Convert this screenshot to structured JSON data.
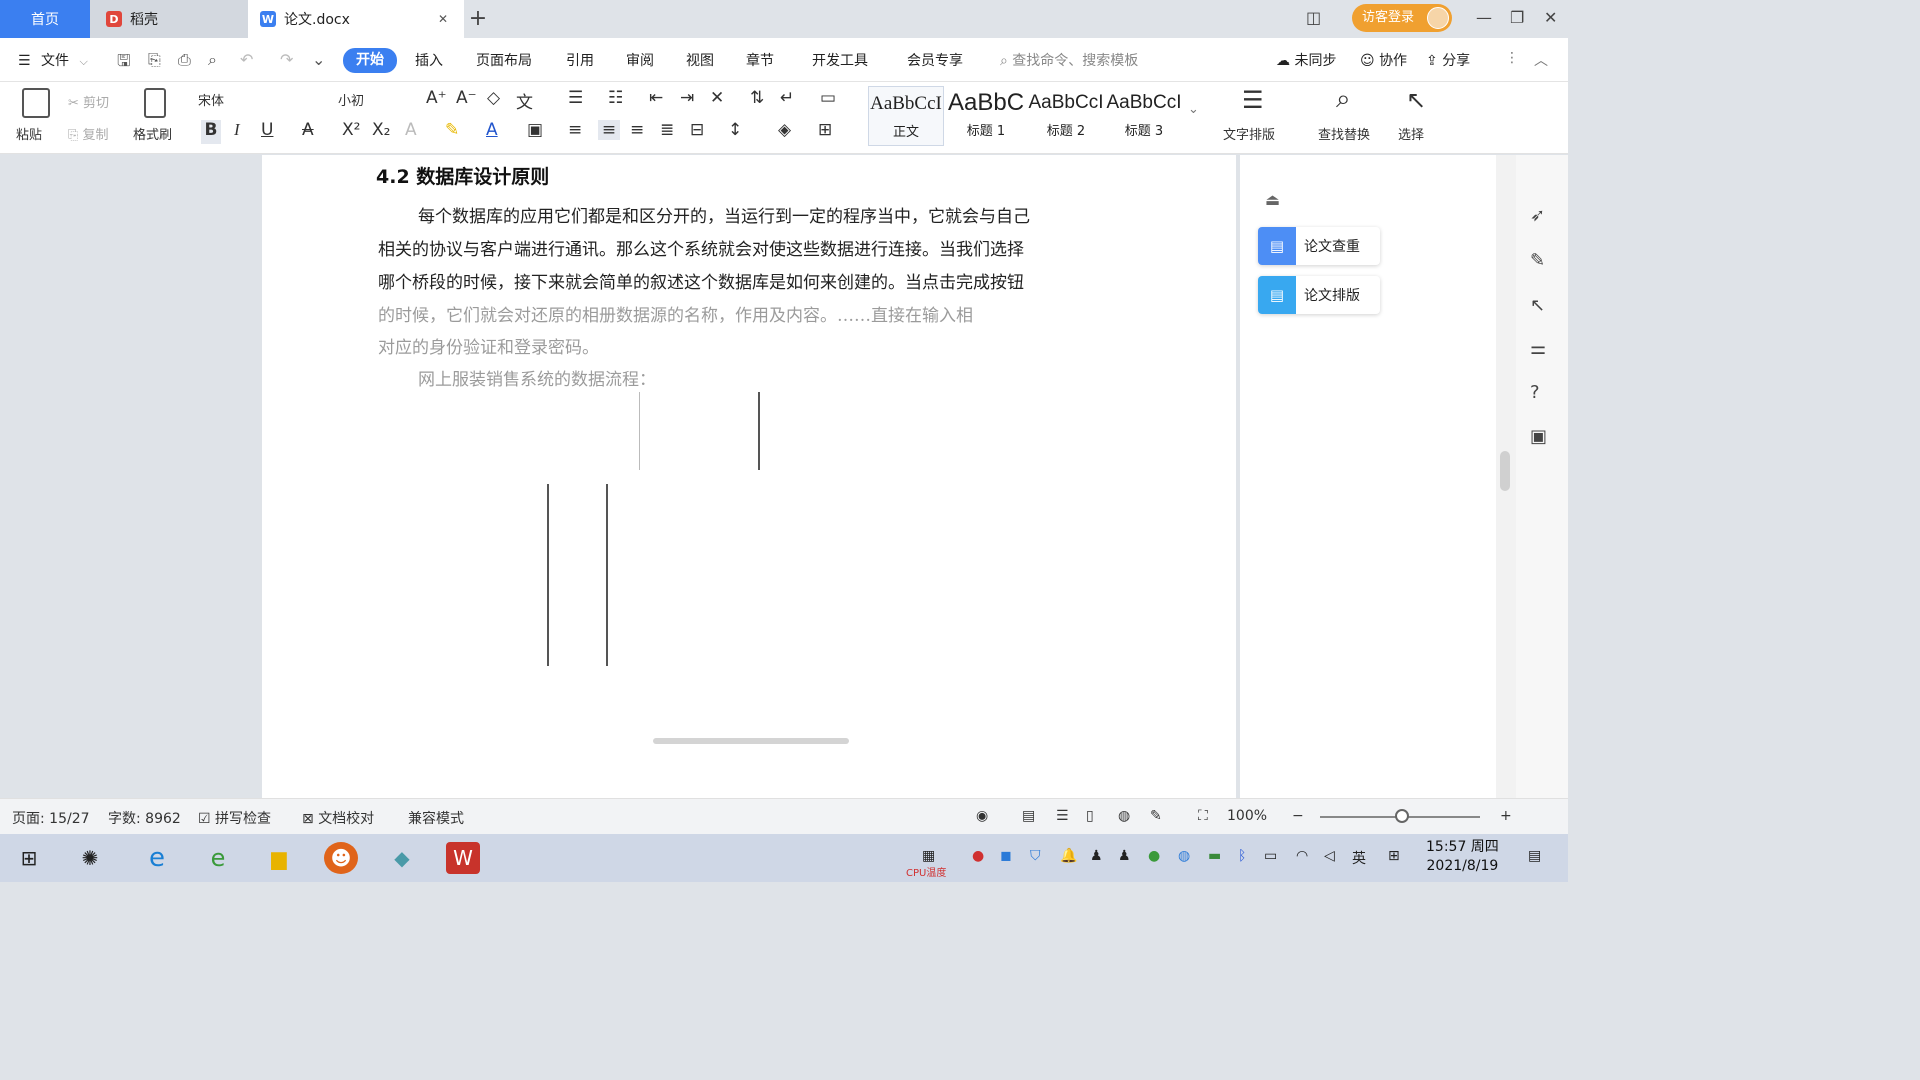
{
  "tabs": {
    "home": "首页",
    "daoke": "稻壳",
    "doc": "论文.docx",
    "login": "访客登录"
  },
  "menu": {
    "file": "文件",
    "items": [
      "开始",
      "插入",
      "页面布局",
      "引用",
      "审阅",
      "视图",
      "章节",
      "开发工具",
      "会员专享"
    ],
    "search_placeholder": "查找命令、搜索模板",
    "unsync": "未同步",
    "collab": "协作",
    "share": "分享"
  },
  "ribbon": {
    "paste": "粘贴",
    "cut": "剪切",
    "copy": "复制",
    "format_painter": "格式刷",
    "font_name": "宋体",
    "font_size": "小初",
    "styles": [
      {
        "sample": "AaBbCcI",
        "label": "正文"
      },
      {
        "sample": "AaBbC",
        "label": "标题 1"
      },
      {
        "sample": "AaBbCcI",
        "label": "标题 2"
      },
      {
        "sample": "AaBbCcI",
        "label": "标题 3"
      }
    ],
    "text_layout": "文字排版",
    "find_replace": "查找替换",
    "select": "选择"
  },
  "document": {
    "heading": "4.2  数据库设计原则",
    "paragraphs": [
      "每个数据库的应用它们都是和区分开的，当运行到一定的程序当中，它就会与自己",
      "相关的协议与客户端进行通讯。那么这个系统就会对使这些数据进行连接。当我们选择",
      "哪个桥段的时候，接下来就会简单的叙述这个数据库是如何来创建的。当点击完成按钮",
      "的时候，它们就会对还原的相册数据源的名称，作用及内容。……直接在输入相",
      "对应的身份验证和登录密码。",
      "网上服装销售系统的数据流程："
    ]
  },
  "side_panel": {
    "check": "论文查重",
    "format": "论文排版"
  },
  "status": {
    "page": "页面: 15/27",
    "words": "字数: 8962",
    "spell": "拼写检查",
    "proof": "文档校对",
    "compat": "兼容模式",
    "zoom": "100%"
  },
  "taskbar": {
    "time": "15:57 周四",
    "date": "2021/8/19",
    "ime": "英",
    "cpu_label": "CPU温度"
  }
}
